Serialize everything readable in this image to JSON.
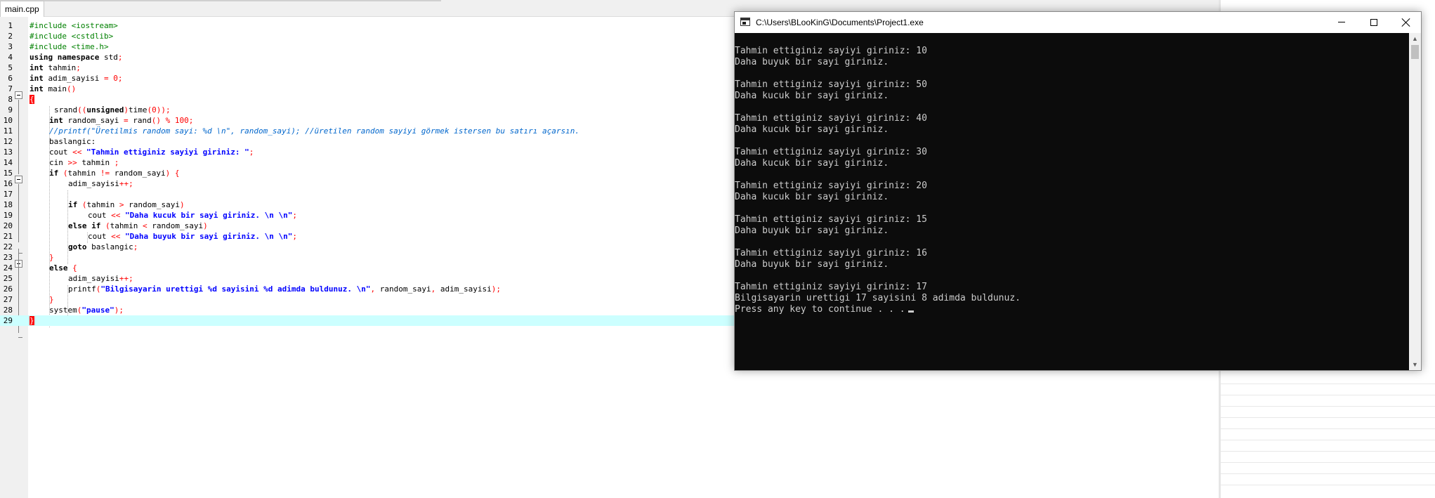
{
  "ide": {
    "tab_label": "main.cpp"
  },
  "line_numbers": [
    "1",
    "2",
    "3",
    "4",
    "5",
    "6",
    "7",
    "8",
    "9",
    "10",
    "11",
    "12",
    "13",
    "14",
    "15",
    "16",
    "17",
    "18",
    "19",
    "20",
    "21",
    "22",
    "23",
    "24",
    "25",
    "26",
    "27",
    "28",
    "29"
  ],
  "code": {
    "l1_a": "#include <iostream>",
    "l2_a": "#include <cstdlib>",
    "l3_a": "#include <time.h>",
    "l4_a": "using namespace",
    "l4_b": " std",
    "l4_c": ";",
    "l5_a": "int",
    "l5_b": " tahmin",
    "l5_c": ";",
    "l6_a": "int",
    "l6_b": " adim_sayisi ",
    "l6_c": "=",
    "l6_d": " ",
    "l6_e": "0",
    "l6_f": ";",
    "l7_a": "int",
    "l7_b": " main",
    "l7_c": "()",
    "l8_a": "{",
    "l9_a": "srand",
    "l9_b": "((",
    "l9_c": "unsigned",
    "l9_d": ")",
    "l9_e": "time",
    "l9_f": "(",
    "l9_g": "0",
    "l9_h": "));",
    "l10_a": "int",
    "l10_b": " random_sayi ",
    "l10_c": "=",
    "l10_d": " rand",
    "l10_e": "()",
    "l10_f": " ",
    "l10_g": "%",
    "l10_h": " ",
    "l10_i": "100",
    "l10_j": ";",
    "l11_a": "//printf(\"Üretilmis random sayi: %d \\n\", random_sayi); //üretilen random sayiyi görmek istersen bu satırı açarsın.",
    "l12_a": "baslangic:",
    "l13_a": "cout ",
    "l13_b": "<<",
    "l13_c": " ",
    "l13_d": "\"Tahmin ettiginiz sayiyi giriniz: \"",
    "l13_e": ";",
    "l14_a": "cin ",
    "l14_b": ">>",
    "l14_c": " tahmin ",
    "l14_d": ";",
    "l15_a": "if",
    "l15_b": " ",
    "l15_c": "(",
    "l15_d": "tahmin ",
    "l15_e": "!=",
    "l15_f": " random_sayi",
    "l15_g": ")",
    "l15_h": " ",
    "l15_i": "{",
    "l16_a": "adim_sayisi",
    "l16_b": "++;",
    "l18_a": "if",
    "l18_b": " ",
    "l18_c": "(",
    "l18_d": "tahmin ",
    "l18_e": ">",
    "l18_f": " random_sayi",
    "l18_g": ")",
    "l19_a": "cout ",
    "l19_b": "<<",
    "l19_c": " ",
    "l19_d": "\"Daha kucuk bir sayi giriniz. \\n \\n\"",
    "l19_e": ";",
    "l20_a": "else if",
    "l20_b": " ",
    "l20_c": "(",
    "l20_d": "tahmin ",
    "l20_e": "<",
    "l20_f": " random_sayi",
    "l20_g": ")",
    "l21_a": "cout ",
    "l21_b": "<<",
    "l21_c": " ",
    "l21_d": "\"Daha buyuk bir sayi giriniz. \\n \\n\"",
    "l21_e": ";",
    "l22_a": "goto",
    "l22_b": " baslangic",
    "l22_c": ";",
    "l23_a": "}",
    "l24_a": "else",
    "l24_b": " ",
    "l24_c": "{",
    "l25_a": "adim_sayisi",
    "l25_b": "++;",
    "l26_a": "printf",
    "l26_b": "(",
    "l26_c": "\"Bilgisayarin urettigi %d sayisini %d adimda buldunuz. \\n\"",
    "l26_d": ",",
    "l26_e": " random_sayi",
    "l26_f": ",",
    "l26_g": " adim_sayisi",
    "l26_h": ");",
    "l27_a": "}",
    "l28_a": "system",
    "l28_b": "(",
    "l28_c": "\"pause\"",
    "l28_d": ");",
    "l29_a": "}"
  },
  "console": {
    "title": "C:\\Users\\BLooKinG\\Documents\\Project1.exe",
    "output": [
      "Tahmin ettiginiz sayiyi giriniz: 10",
      "Daha buyuk bir sayi giriniz.",
      "",
      "Tahmin ettiginiz sayiyi giriniz: 50",
      "Daha kucuk bir sayi giriniz.",
      "",
      "Tahmin ettiginiz sayiyi giriniz: 40",
      "Daha kucuk bir sayi giriniz.",
      "",
      "Tahmin ettiginiz sayiyi giriniz: 30",
      "Daha kucuk bir sayi giriniz.",
      "",
      "Tahmin ettiginiz sayiyi giriniz: 20",
      "Daha kucuk bir sayi giriniz.",
      "",
      "Tahmin ettiginiz sayiyi giriniz: 15",
      "Daha buyuk bir sayi giriniz.",
      "",
      "Tahmin ettiginiz sayiyi giriniz: 16",
      "Daha buyuk bir sayi giriniz.",
      "",
      "Tahmin ettiginiz sayiyi giriniz: 17",
      "Bilgisayarin urettigi 17 sayisini 8 adimda buldunuz.",
      "Press any key to continue . . ."
    ]
  },
  "icons": {
    "minimize": "minimize-icon",
    "maximize": "maximize-icon",
    "close": "close-icon",
    "console": "console-app-icon",
    "fold": "fold-collapse-icon"
  },
  "colors": {
    "preprocessor": "#008000",
    "keyword": "#000000",
    "operator": "#ff0000",
    "string": "#0000ff",
    "comment": "#0066cc",
    "active_line": "#ccffff",
    "console_bg": "#0c0c0c",
    "console_fg": "#cccccc"
  }
}
